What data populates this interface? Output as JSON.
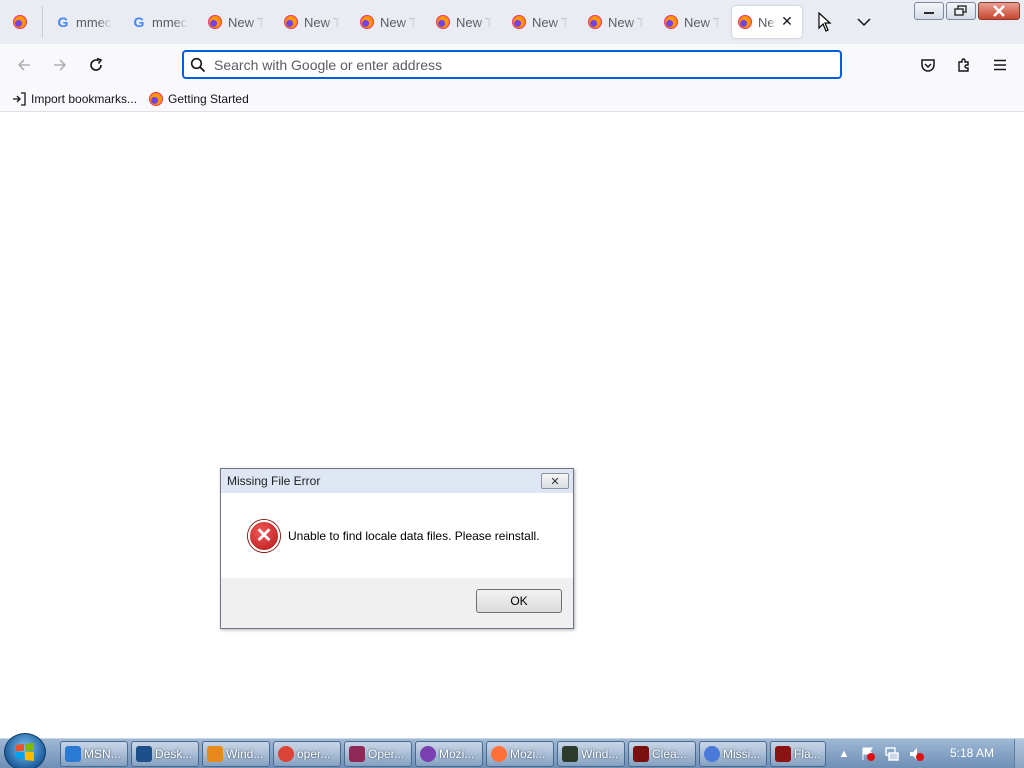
{
  "browser": {
    "tabs": [
      {
        "label": "",
        "icon": "firefox-icon"
      },
      {
        "label": "mmec",
        "icon": "google-icon"
      },
      {
        "label": "mmec",
        "icon": "google-icon"
      },
      {
        "label": "New Tab",
        "icon": "firefox-icon"
      },
      {
        "label": "New Tab",
        "icon": "firefox-icon"
      },
      {
        "label": "New Tab",
        "icon": "firefox-icon"
      },
      {
        "label": "New Tab",
        "icon": "firefox-icon"
      },
      {
        "label": "New Tab",
        "icon": "firefox-icon"
      },
      {
        "label": "New Tab",
        "icon": "firefox-icon"
      },
      {
        "label": "New Tab",
        "icon": "firefox-icon"
      },
      {
        "label": "New Tab",
        "icon": "firefox-icon",
        "active": true
      }
    ],
    "search": {
      "placeholder": "Search with Google or enter address"
    },
    "bookmarks": [
      {
        "label": "Import bookmarks...",
        "icon": "import-icon"
      },
      {
        "label": "Getting Started",
        "icon": "firefox-icon"
      }
    ]
  },
  "dialog": {
    "title": "Missing File Error",
    "message": "Unable to find locale data files. Please reinstall.",
    "ok_label": "OK"
  },
  "taskbar": {
    "items": [
      {
        "label": "MSN...",
        "icon": "ie-icon",
        "color": "#2a7bd4"
      },
      {
        "label": "Desk...",
        "icon": "desktop-icon",
        "color": "#1d4f8a"
      },
      {
        "label": "Wind...",
        "icon": "media-player-icon",
        "color": "#e88a1a"
      },
      {
        "label": "oper...",
        "icon": "chrome-icon",
        "color": "#db4437"
      },
      {
        "label": "Oper...",
        "icon": "opera-icon",
        "color": "#8e2a55"
      },
      {
        "label": "Mozi...",
        "icon": "mask-icon",
        "color": "#7a3fb0"
      },
      {
        "label": "Mozi...",
        "icon": "firefox-icon",
        "color": "#ff7139"
      },
      {
        "label": "Wind...",
        "icon": "terminal-icon",
        "color": "#2b3a2b"
      },
      {
        "label": "Clea...",
        "icon": "cleaner-icon",
        "color": "#7a1010"
      },
      {
        "label": "Missi...",
        "icon": "chromium-icon",
        "color": "#4a7bd8"
      },
      {
        "label": "Fla...",
        "icon": "flash-icon",
        "color": "#8a1414"
      }
    ],
    "clock": "5:18 AM"
  }
}
